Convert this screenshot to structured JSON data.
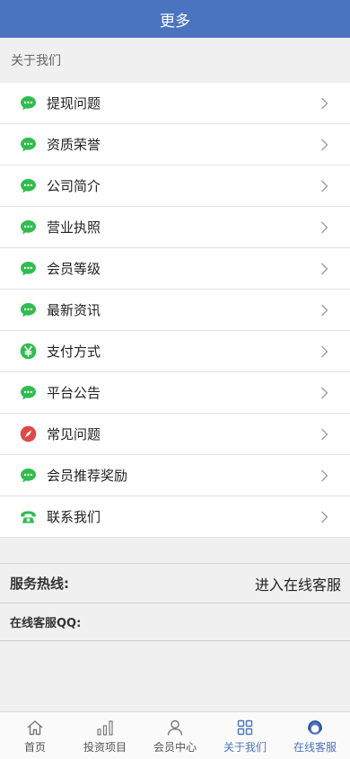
{
  "header": {
    "title": "更多"
  },
  "section": {
    "title": "关于我们"
  },
  "menu": [
    {
      "label": "提现问题",
      "icon": "chat-bubble-icon"
    },
    {
      "label": "资质荣誉",
      "icon": "chat-bubble-icon"
    },
    {
      "label": "公司简介",
      "icon": "chat-bubble-icon"
    },
    {
      "label": "营业执照",
      "icon": "chat-bubble-icon"
    },
    {
      "label": "会员等级",
      "icon": "chat-bubble-icon"
    },
    {
      "label": "最新资讯",
      "icon": "chat-bubble-icon"
    },
    {
      "label": "支付方式",
      "icon": "yen-icon",
      "symbol": "¥"
    },
    {
      "label": "平台公告",
      "icon": "chat-bubble-icon"
    },
    {
      "label": "常见问题",
      "icon": "compass-icon"
    },
    {
      "label": "会员推荐奖励",
      "icon": "chat-bubble-icon"
    },
    {
      "label": "联系我们",
      "icon": "phone-icon"
    }
  ],
  "hotline": {
    "label": "服务热线:",
    "link": "进入在线客服"
  },
  "qq": {
    "label": "在线客服QQ:"
  },
  "tabbar": [
    {
      "label": "首页",
      "icon": "home-icon"
    },
    {
      "label": "投资项目",
      "icon": "bar-chart-icon"
    },
    {
      "label": "会员中心",
      "icon": "user-icon"
    },
    {
      "label": "关于我们",
      "icon": "grid-icon",
      "active": true
    },
    {
      "label": "在线客服",
      "icon": "support-icon",
      "active": true
    }
  ],
  "colors": {
    "header_bg": "#4a74bf",
    "icon_green": "#2fbd4e",
    "icon_red": "#e04848",
    "active_tab": "#4a74bf"
  }
}
